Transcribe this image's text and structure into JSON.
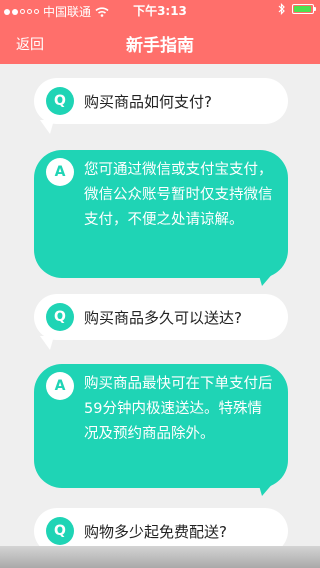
{
  "status": {
    "carrier": "中国联通",
    "time": "下午3:13",
    "battery_level": 0.95,
    "battery_color": "#4ee04e"
  },
  "nav": {
    "back_label": "返回",
    "title": "新手指南"
  },
  "faq": [
    {
      "q_badge": "Q",
      "question": "购买商品如何支付?",
      "a_badge": "A",
      "answer": "您可通过微信或支付宝支付，微信公众账号暂时仅支持微信支付，不便之处请谅解。"
    },
    {
      "q_badge": "Q",
      "question": "购买商品多久可以送达?",
      "a_badge": "A",
      "answer": "购买商品最快可在下单支付后59分钟内极速送达。特殊情况及预约商品除外。"
    },
    {
      "q_badge": "Q",
      "question": "购物多少起免费配送?"
    }
  ],
  "colors": {
    "header": "#ff6f6b",
    "accent": "#1fd4b5",
    "background": "#efefef"
  }
}
